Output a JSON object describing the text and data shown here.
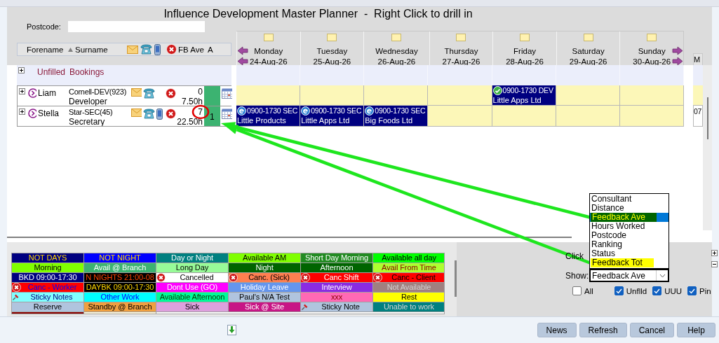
{
  "title": "Influence Development Master Planner  -  Right Click to drill in",
  "postcode": {
    "label": "Postcode:"
  },
  "columns": {
    "forename": "Forename",
    "surname": "Surname",
    "feedback": "FB Ave",
    "column_a": "A"
  },
  "days": [
    {
      "day": "Monday",
      "date": "24-Aug-26"
    },
    {
      "day": "Tuesday",
      "date": "25-Aug-26"
    },
    {
      "day": "Wednesday",
      "date": "26-Aug-26"
    },
    {
      "day": "Thursday",
      "date": "27-Aug-26"
    },
    {
      "day": "Friday",
      "date": "28-Aug-26"
    },
    {
      "day": "Saturday",
      "date": "29-Aug-26"
    },
    {
      "day": "Sunday",
      "date": "30-Aug-26"
    }
  ],
  "next_day": "M",
  "rows": [
    {
      "kind": "group",
      "forename": "Unfilled",
      "surname": "Bookings"
    },
    {
      "kind": "worker",
      "forename": "Liam",
      "surname": "Cornell-DEV(923)",
      "role": "Developer",
      "has_mobile": false,
      "score": "0",
      "hours": "7.50h",
      "highlighted": false,
      "cells": [
        {
          "kind": "empty"
        },
        {
          "kind": "empty"
        },
        {
          "kind": "empty"
        },
        {
          "kind": "empty"
        },
        {
          "kind": "confirmed",
          "time": "0900-1730 DEV",
          "client": "Little Apps Ltd"
        },
        {
          "kind": "empty"
        },
        {
          "kind": "empty"
        }
      ]
    },
    {
      "kind": "worker",
      "forename": "Stella",
      "surname": "Star-SEC(45)",
      "role": "Secretary",
      "has_mobile": true,
      "score": "7",
      "hours": "22.50h",
      "count": "1",
      "highlighted": true,
      "next": "07",
      "cells": [
        {
          "kind": "pending",
          "time": "0900-1730 SEC",
          "client": "Little Products"
        },
        {
          "kind": "pending",
          "time": "0900-1730 SEC",
          "client": "Little Apps Ltd"
        },
        {
          "kind": "pending",
          "time": "0900-1730 SEC",
          "client": "Big Foods Ltd"
        },
        {
          "kind": "empty"
        },
        {
          "kind": "empty"
        },
        {
          "kind": "empty"
        },
        {
          "kind": "empty"
        }
      ]
    }
  ],
  "legend": [
    {
      "items": [
        {
          "label": "NOT DAYS",
          "color": "#000080",
          "text": {
            "kind": "gold"
          },
          "kind": "plain"
        },
        {
          "label": "NOT NIGHT",
          "color": "#0000ff",
          "text": {
            "kind": "gold"
          },
          "kind": "plain"
        },
        {
          "label": "Day or Night",
          "color": "#008080",
          "text": {
            "kind": "light"
          },
          "kind": "plain"
        },
        {
          "label": "Available AM",
          "color": "#80ff00",
          "text": {
            "kind": "dark"
          },
          "kind": "plain"
        },
        {
          "label": "Short Day Morning",
          "color": "#228b22",
          "text": {
            "kind": "light"
          },
          "kind": "plain"
        },
        {
          "label": "Available all day",
          "color": "#00ff00",
          "text": {
            "kind": "dark"
          },
          "kind": "plain"
        }
      ]
    },
    {
      "items": [
        {
          "label": "Morning",
          "color": "#80ff00",
          "text": {
            "kind": "dark"
          },
          "kind": "plain"
        },
        {
          "label": "Avail @ Branch",
          "color": "#3cb371",
          "text": {
            "kind": "light"
          },
          "kind": "plain"
        },
        {
          "label": "Long Day",
          "color": "#98fb98",
          "text": {
            "kind": "dark"
          },
          "kind": "plain"
        },
        {
          "label": "Night",
          "color": "#006400",
          "text": {
            "kind": "light"
          },
          "kind": "plain"
        },
        {
          "label": "Afternoon",
          "color": "#006400",
          "text": {
            "kind": "light"
          },
          "kind": "plain"
        },
        {
          "label": "Avail From Time",
          "color": "#adff2f",
          "text": {
            "kind": "maroon"
          },
          "kind": "plain"
        }
      ]
    },
    {
      "items": [
        {
          "label": "BKD 09:00-17:30",
          "color": "#000080",
          "text": {
            "kind": "light"
          },
          "kind": "plain"
        },
        {
          "label": "N NIGHTS 21:00-08",
          "color": "#000000",
          "text": {
            "kind": "orange"
          },
          "kind": "plain"
        },
        {
          "label": "Cancelled",
          "color": "#ffffff",
          "text": {
            "kind": "dark"
          },
          "kind": "cancel"
        },
        {
          "label": "Canc. (Sick)",
          "color": "#ff7f50",
          "text": {
            "kind": "dark"
          },
          "kind": "cancel"
        },
        {
          "label": "Canc Shift",
          "color": "#ff0000",
          "text": {
            "kind": "light"
          },
          "kind": "cancel"
        },
        {
          "label": "Canc - Client",
          "color": "#ff0000",
          "text": {
            "kind": "dark"
          },
          "kind": "cancel"
        }
      ]
    },
    {
      "items": [
        {
          "label": "Canc - Worker",
          "color": "#ff0000",
          "text": {
            "kind": "blue"
          },
          "kind": "cancel"
        },
        {
          "label": "DAYBK 09:00-17:30",
          "color": "#000000",
          "text": {
            "kind": "gold"
          },
          "kind": "plain"
        },
        {
          "label": "Dont Use (GO)",
          "color": "#ff00ff",
          "text": {
            "kind": "light"
          },
          "kind": "plain"
        },
        {
          "label": "Holiday Leave",
          "color": "#6495ed",
          "text": {
            "kind": "light"
          },
          "kind": "plain"
        },
        {
          "label": "Interview",
          "color": "#8a2be2",
          "text": {
            "kind": "light"
          },
          "kind": "plain"
        },
        {
          "label": "Not Available",
          "color": "#a08080",
          "text": {
            "kind": "pale"
          },
          "kind": "plain"
        }
      ]
    },
    {
      "items": [
        {
          "label": "Sticky Notes",
          "color": "#80ffff",
          "text": {
            "kind": "navy"
          },
          "kind": "pin"
        },
        {
          "label": "Other Work",
          "color": "#00ffff",
          "text": {
            "kind": "blue"
          },
          "kind": "plain"
        },
        {
          "label": "Available Afternoon",
          "color": "#00fa9a",
          "text": {
            "kind": "green"
          },
          "kind": "plain"
        },
        {
          "label": "Paul's N/A Test",
          "color": "#b0c4de",
          "text": {
            "kind": "dark"
          },
          "kind": "plain"
        },
        {
          "label": "xxx",
          "color": "#ff69b4",
          "text": {
            "kind": "maroon"
          },
          "kind": "plain"
        },
        {
          "label": "Rest",
          "color": "#ffff00",
          "text": {
            "kind": "dark"
          },
          "kind": "plain"
        }
      ]
    },
    {
      "items": [
        {
          "label": "Reserve",
          "color": "#b0c4de",
          "text": {
            "kind": "dark"
          },
          "kind": "plain"
        },
        {
          "label": "Standby @ Branch",
          "color": "#f0a040",
          "text": {
            "kind": "dark"
          },
          "kind": "plain"
        },
        {
          "label": "Sick",
          "color": "#dda0dd",
          "text": {
            "kind": "dark"
          },
          "kind": "plain"
        },
        {
          "label": "Sick @ Site",
          "color": "#c71585",
          "text": {
            "kind": "light"
          },
          "kind": "plain"
        },
        {
          "label": "Sticky Note",
          "color": "#b0c4de",
          "text": {
            "kind": "dark"
          },
          "kind": "pin"
        },
        {
          "label": "Unable to work",
          "color": "#008080",
          "text": {
            "kind": "pale"
          },
          "kind": "plain"
        }
      ]
    },
    {
      "items": [
        {
          "color": "#8b0000",
          "kind": "plain"
        },
        {
          "color": "#fff8dc",
          "kind": "plain"
        }
      ]
    }
  ],
  "filters": {
    "click_label": "Click",
    "show_label": "Show:",
    "show_value": "Feedback Ave",
    "options": [
      {
        "label": "Consultant",
        "selected": false
      },
      {
        "label": "Distance",
        "selected": false
      },
      {
        "label": "Feedback Ave",
        "selected": true,
        "color": "#006400",
        "text": {
          "kind": "yellow"
        }
      },
      {
        "label": "Hours Worked",
        "selected": false
      },
      {
        "label": "Postcode",
        "selected": false
      },
      {
        "label": "Ranking",
        "selected": false
      },
      {
        "label": "Status",
        "selected": false
      },
      {
        "label": "Feedback Tot",
        "selected": false,
        "color": "#ffff00",
        "text": {
          "kind": "dark"
        }
      }
    ],
    "checkboxes": [
      {
        "label": "All",
        "checked": false
      },
      {
        "label": "Unflld",
        "checked": true
      },
      {
        "label": "UUU",
        "checked": true
      },
      {
        "label": "Pin",
        "checked": true
      }
    ]
  },
  "buttons": [
    "News",
    "Refresh",
    "Cancel",
    "Help"
  ]
}
